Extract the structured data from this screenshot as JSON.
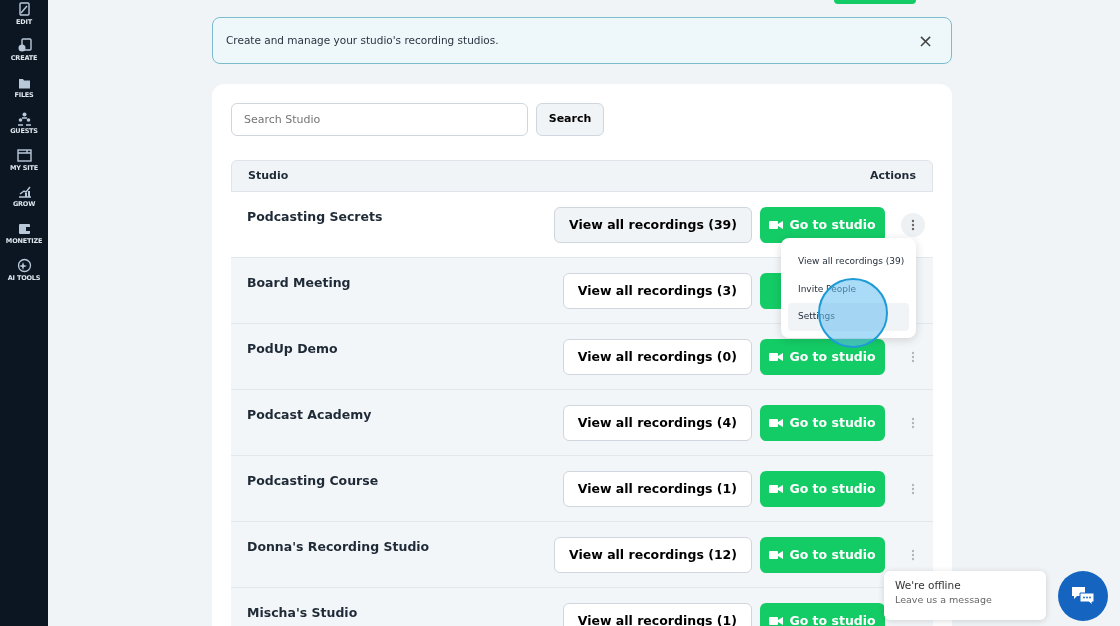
{
  "sidebar": {
    "items": [
      {
        "label": "EDIT",
        "kind": "edit"
      },
      {
        "label": "CREATE",
        "kind": "create"
      },
      {
        "label": "FILES",
        "kind": "files"
      },
      {
        "label": "GUESTS",
        "kind": "guests"
      },
      {
        "label": "MY SITE",
        "kind": "site"
      },
      {
        "label": "GROW",
        "kind": "grow"
      },
      {
        "label": "MONETIZE",
        "kind": "monetize"
      },
      {
        "label": "AI TOOLS",
        "kind": "ai"
      }
    ]
  },
  "alert": {
    "text": "Create and manage your studio's recording studios.",
    "close": "×"
  },
  "search": {
    "placeholder": "Search Studio",
    "button": "Search"
  },
  "table": {
    "columns": [
      "Studio",
      "Actions"
    ],
    "rows": [
      {
        "name": "Podcasting Secrets",
        "recordings": "View all recordings (39)",
        "go": "Go to studio",
        "menu_open": true,
        "more": true
      },
      {
        "name": "Board Meeting",
        "recordings": "View all recordings (3)",
        "menu_open": false,
        "more": false
      },
      {
        "name": "PodUp Demo",
        "recordings": "View all recordings (0)",
        "go": "Go to studio",
        "menu_open": false,
        "more": true
      },
      {
        "name": "Podcast Academy",
        "recordings": "View all recordings (4)",
        "go": "Go to studio",
        "menu_open": false,
        "more": true
      },
      {
        "name": "Podcasting Course",
        "recordings": "View all recordings (1)",
        "go": "Go to studio",
        "menu_open": false,
        "more": true
      },
      {
        "name": "Donna's Recording Studio",
        "recordings": "View all recordings (12)",
        "go": "Go to studio",
        "menu_open": false,
        "more": true
      },
      {
        "name": "Mischa's Studio",
        "recordings": "View all recordings (1)",
        "go": "Go to studio",
        "menu_open": false,
        "more": false
      }
    ]
  },
  "menu": {
    "items": [
      {
        "label": "View all recordings (39)",
        "selected": false
      },
      {
        "label": "Invite People",
        "selected": false
      },
      {
        "label": "Settings",
        "selected": true
      }
    ]
  },
  "chat": {
    "title": "We're offline",
    "subtitle": "Leave us a message"
  }
}
